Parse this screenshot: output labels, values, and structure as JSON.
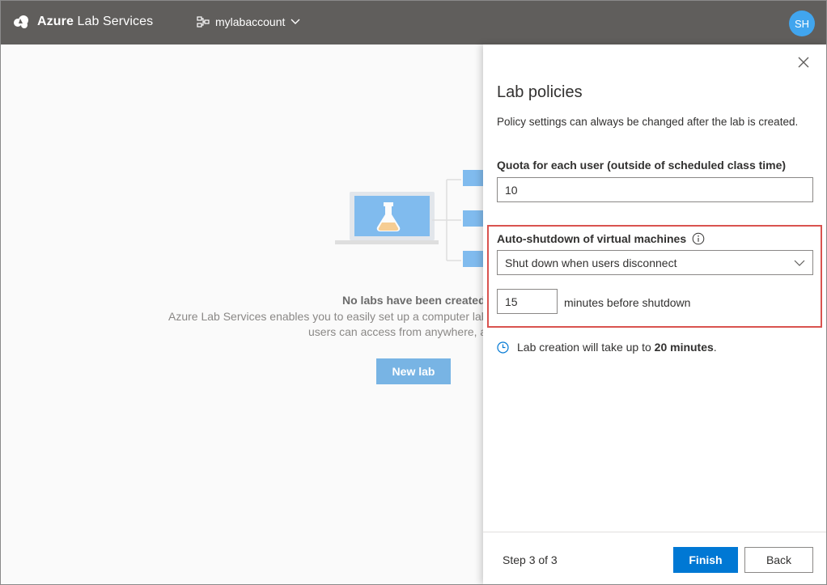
{
  "topbar": {
    "brand_strong": "Azure",
    "brand_rest": "Lab Services",
    "account_name": "mylabaccount",
    "avatar_initials": "SH",
    "color": "#605e5c"
  },
  "main": {
    "empty_title": "No labs have been created.",
    "empty_desc_line1": "Azure Lab Services enables you to easily set up a computer lab",
    "empty_desc_line2": "users can access from anywhere, ar",
    "new_lab_label": "New lab"
  },
  "panel": {
    "title": "Lab policies",
    "subtitle": "Policy settings can always be changed after the lab is created.",
    "quota_label": "Quota for each user (outside of scheduled class time)",
    "quota_value": "10",
    "auto_shutdown_label": "Auto-shutdown of virtual machines",
    "shutdown_option": "Shut down when users disconnect",
    "minutes_value": "15",
    "minutes_label": "minutes before shutdown",
    "creation_note_prefix": "Lab creation will take up to ",
    "creation_note_time": "20 minutes",
    "creation_note_suffix": ".",
    "step_text": "Step 3 of 3",
    "finish_label": "Finish",
    "back_label": "Back"
  },
  "colors": {
    "primary": "#0078d4",
    "highlight": "#d9534f",
    "avatar": "#41a5ee"
  }
}
